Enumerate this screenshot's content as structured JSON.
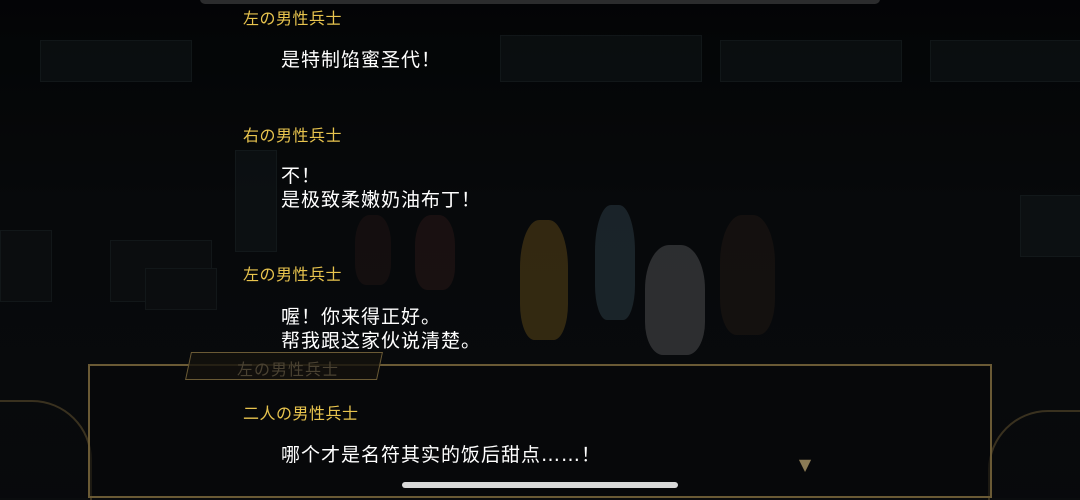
{
  "backlog": {
    "entries": [
      {
        "speaker": "左の男性兵士",
        "lines": [
          "是特制馅蜜圣代！"
        ]
      },
      {
        "speaker": "右の男性兵士",
        "lines": [
          "不！",
          "是极致柔嫩奶油布丁！"
        ]
      },
      {
        "speaker": "左の男性兵士",
        "lines": [
          "喔！你来得正好。",
          "帮我跟这家伙说清楚。"
        ]
      },
      {
        "speaker": "二人の男性兵士",
        "lines": [
          "哪个才是名符其实的饭后甜点……！"
        ]
      }
    ]
  },
  "game_window": {
    "nameplate": "左の男性兵士",
    "next_icon": "chevron-down-icon"
  },
  "colors": {
    "speaker": "#e8c44e",
    "text": "#ffffff",
    "frame": "#6a5a35"
  }
}
